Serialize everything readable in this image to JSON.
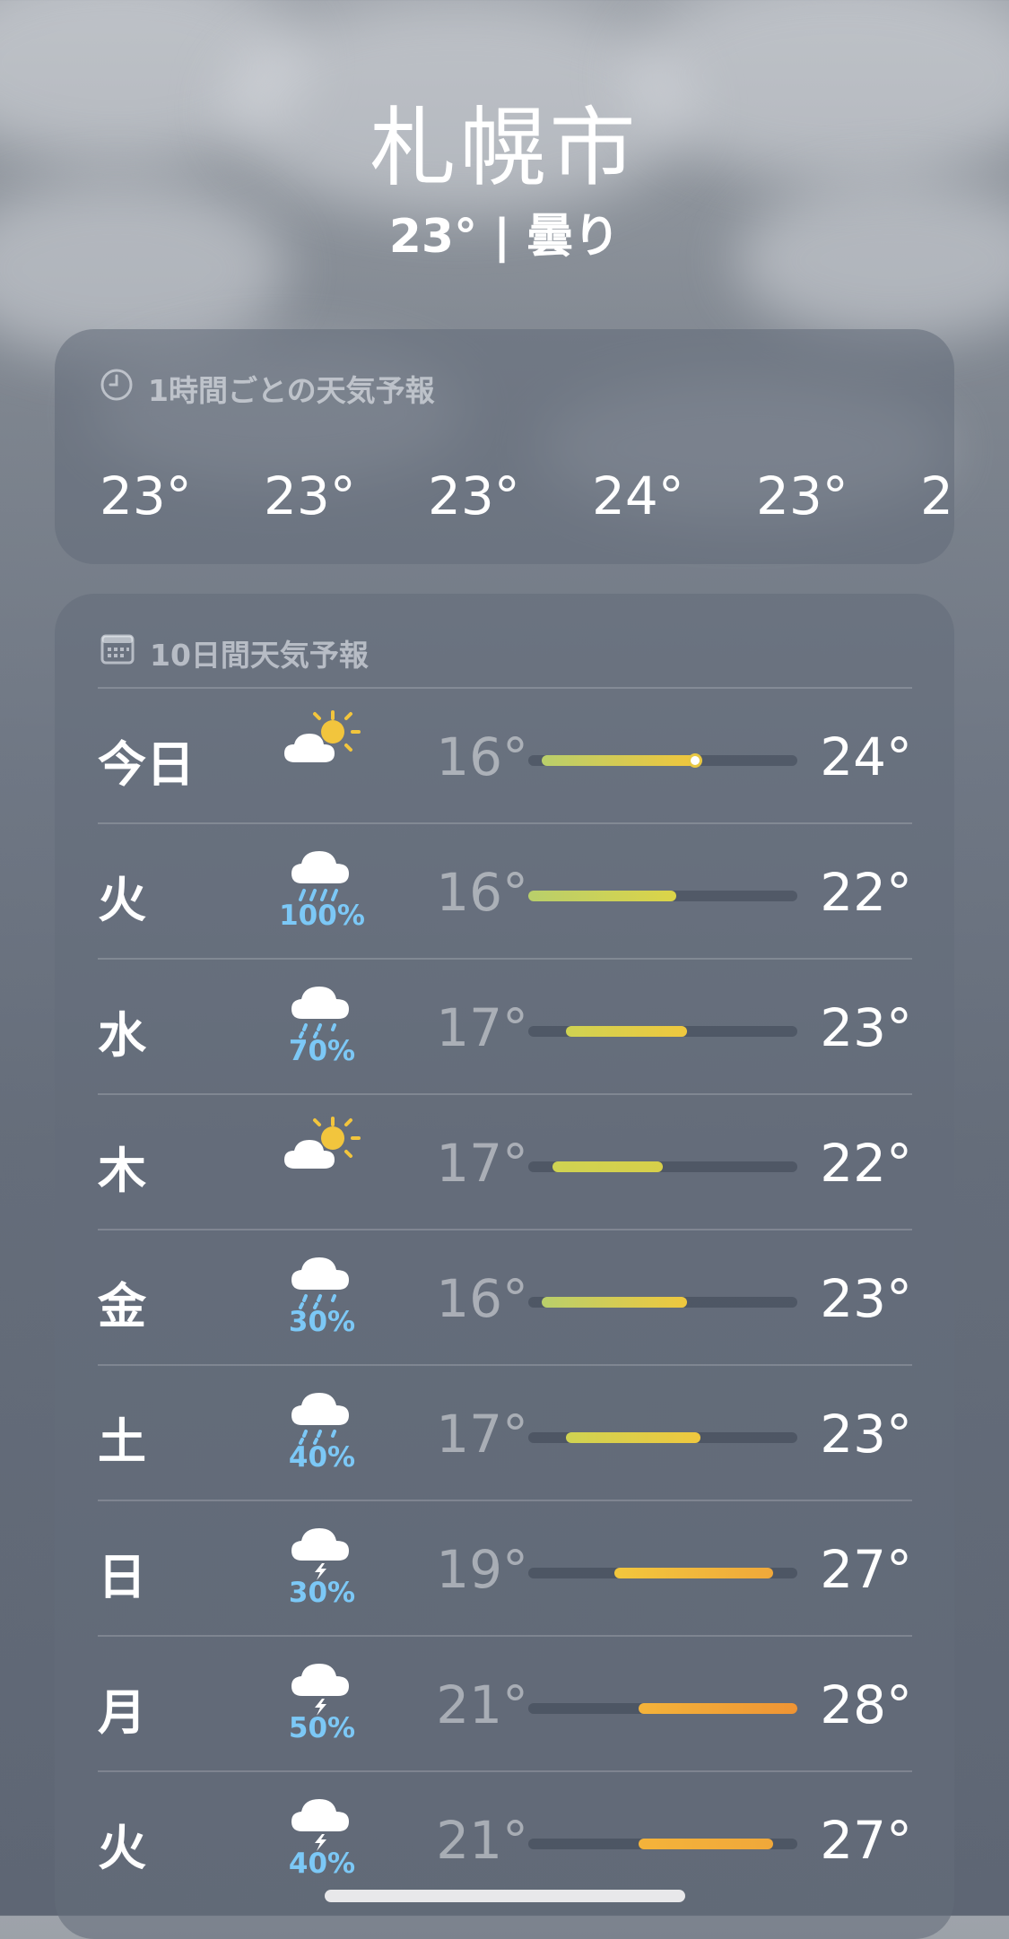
{
  "location": {
    "city": "札幌市",
    "current": "23° | 曇り"
  },
  "hourly": {
    "title": "1時間ごとの天気予報",
    "icon": "clock-icon",
    "temps": [
      "23°",
      "23°",
      "23°",
      "24°",
      "23°",
      "2"
    ]
  },
  "daily": {
    "title": "10日間天気予報",
    "icon": "calendar-icon",
    "days": [
      {
        "day": "今日",
        "icon": "partly-sunny-icon",
        "pop": "",
        "low": "16°",
        "high": "24°",
        "range_start": 0.05,
        "range_end": 0.62,
        "current_pos": 0.62,
        "colors": [
          "#b9cf6b",
          "#f0c63c"
        ]
      },
      {
        "day": "火",
        "icon": "rain-cloud-icon",
        "pop": "100%",
        "low": "16°",
        "high": "22°",
        "range_start": 0.0,
        "range_end": 0.55,
        "colors": [
          "#b9cf6b",
          "#dcd448"
        ]
      },
      {
        "day": "水",
        "icon": "drizzle-cloud-icon",
        "pop": "70%",
        "low": "17°",
        "high": "23°",
        "range_start": 0.14,
        "range_end": 0.59,
        "colors": [
          "#cfd352",
          "#efc83e"
        ]
      },
      {
        "day": "木",
        "icon": "partly-sunny-icon",
        "pop": "",
        "low": "17°",
        "high": "22°",
        "range_start": 0.09,
        "range_end": 0.5,
        "colors": [
          "#cfd352",
          "#d7cf4a"
        ]
      },
      {
        "day": "金",
        "icon": "drizzle-cloud-icon",
        "pop": "30%",
        "low": "16°",
        "high": "23°",
        "range_start": 0.05,
        "range_end": 0.59,
        "colors": [
          "#b9cf6b",
          "#efc83e"
        ]
      },
      {
        "day": "土",
        "icon": "drizzle-cloud-icon",
        "pop": "40%",
        "low": "17°",
        "high": "23°",
        "range_start": 0.14,
        "range_end": 0.64,
        "colors": [
          "#cfd352",
          "#efc83e"
        ]
      },
      {
        "day": "日",
        "icon": "thunder-cloud-icon",
        "pop": "30%",
        "low": "19°",
        "high": "27°",
        "range_start": 0.32,
        "range_end": 0.91,
        "colors": [
          "#f2c73d",
          "#f0a83a"
        ]
      },
      {
        "day": "月",
        "icon": "thunder-cloud-icon",
        "pop": "50%",
        "low": "21°",
        "high": "28°",
        "range_start": 0.41,
        "range_end": 1.0,
        "colors": [
          "#f4b33a",
          "#ef9434"
        ]
      },
      {
        "day": "火",
        "icon": "thunder-cloud-icon",
        "pop": "40%",
        "low": "21°",
        "high": "27°",
        "range_start": 0.41,
        "range_end": 0.91,
        "colors": [
          "#f4b33a",
          "#f0a83a"
        ]
      }
    ]
  }
}
